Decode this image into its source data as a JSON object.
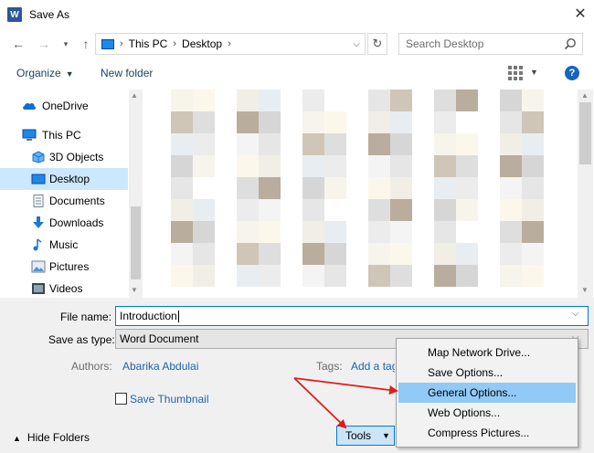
{
  "window": {
    "title": "Save As",
    "app_icon": "W"
  },
  "address": {
    "crumbs": [
      "This PC",
      "Desktop"
    ],
    "search_placeholder": "Search Desktop"
  },
  "toolbar": {
    "organize": "Organize",
    "new_folder": "New folder",
    "help": "?"
  },
  "sidebar": {
    "items": [
      {
        "label": "OneDrive",
        "icon": "cloud-icon"
      },
      {
        "label": "This PC",
        "icon": "computer-icon"
      },
      {
        "label": "3D Objects",
        "icon": "cube-icon"
      },
      {
        "label": "Desktop",
        "icon": "desktop-icon",
        "selected": true
      },
      {
        "label": "Documents",
        "icon": "document-icon"
      },
      {
        "label": "Downloads",
        "icon": "download-icon"
      },
      {
        "label": "Music",
        "icon": "music-icon"
      },
      {
        "label": "Pictures",
        "icon": "picture-icon"
      },
      {
        "label": "Videos",
        "icon": "video-icon"
      }
    ]
  },
  "form": {
    "file_name_label": "File name:",
    "file_name_value": "Introduction",
    "save_as_type_label": "Save as type:",
    "save_as_type_value": "Word Document",
    "authors_label": "Authors:",
    "authors_value": "Abarika Abdulai",
    "tags_label": "Tags:",
    "tags_value": "Add a tag",
    "save_thumbnail_label": "Save Thumbnail"
  },
  "footer": {
    "hide_folders": "Hide Folders",
    "tools": "Tools"
  },
  "tools_menu": {
    "items": [
      {
        "label": "Map Network Drive..."
      },
      {
        "label": "Save Options..."
      },
      {
        "label": "General Options...",
        "highlighted": true
      },
      {
        "label": "Web Options..."
      },
      {
        "label": "Compress Pictures..."
      }
    ]
  },
  "colors": {
    "accent": "#0078d7",
    "selection": "#cce8ff",
    "menu_highlight": "#91c9f7",
    "annotation": "#e21b1b",
    "link": "#1e62b0"
  }
}
